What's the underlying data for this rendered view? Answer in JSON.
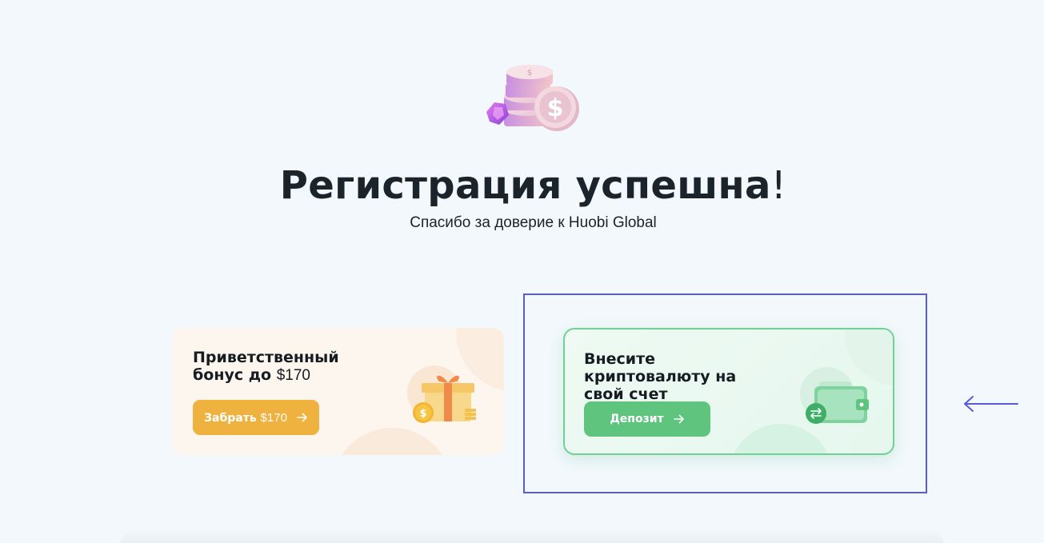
{
  "header": {
    "title": "Регистрация успешна",
    "title_punct": "!",
    "subtitle": "Спасибо за доверие к Huobi Global"
  },
  "cards": [
    {
      "id": "bonus",
      "title_line1": "Приветственный",
      "title_line2_prefix": "бонус до ",
      "title_amount": "$170",
      "button_label": "Забрать",
      "button_amount": "$170",
      "icon": "gift-box-icon",
      "accent": "#f0b23f"
    },
    {
      "id": "deposit",
      "title": "Внесите криптовалюту на свой счет",
      "button_label": "Депозит",
      "icon": "wallet-icon",
      "accent": "#5ec47e",
      "highlighted": true
    }
  ],
  "annotation": {
    "highlight_color": "#5a5bd8",
    "pointer": "left-arrow-icon"
  },
  "hero_icon": "coins-stack-icon"
}
